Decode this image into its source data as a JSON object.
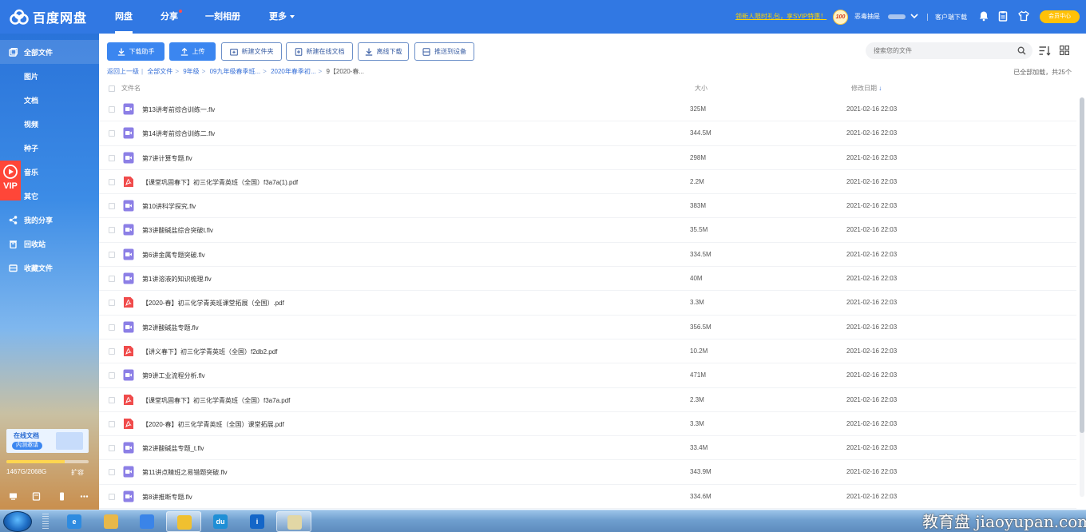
{
  "app": {
    "logo_text": "百度网盘",
    "brand_color": "#3178e3"
  },
  "nav": {
    "tabs": [
      {
        "label": "网盘",
        "active": true
      },
      {
        "label": "分享",
        "has_dot": true
      },
      {
        "label": "一刻相册"
      },
      {
        "label": "更多",
        "has_caret": true
      }
    ]
  },
  "header": {
    "promo": "领新人限时礼包，享SVIP特惠！",
    "badge": "100",
    "username": "恶毒抽是",
    "client_download": "客户端下载",
    "vip_center": "会员中心"
  },
  "sidebar": {
    "items": [
      {
        "label": "全部文件",
        "icon": "folder-icon",
        "active": true
      },
      {
        "label": "图片",
        "sub": true
      },
      {
        "label": "文档",
        "sub": true
      },
      {
        "label": "视频",
        "sub": true
      },
      {
        "label": "种子",
        "sub": true
      },
      {
        "label": "音乐",
        "sub": true
      },
      {
        "label": "其它",
        "sub": true
      },
      {
        "label": "我的分享",
        "icon": "share-icon"
      },
      {
        "label": "回收站",
        "icon": "trash-icon"
      },
      {
        "label": "收藏文件",
        "icon": "favorite-icon"
      }
    ],
    "vip_label": "VIP",
    "doc_banner": {
      "title": "在线文档",
      "tag": "内测邀请"
    },
    "quota": {
      "text": "1467G/2068G",
      "used_fraction": 0.709,
      "expand": "扩容"
    }
  },
  "toolbar": {
    "download_helper": "下载助手",
    "upload": "上传",
    "new_folder": "新建文件夹",
    "new_online_doc": "新建在线文档",
    "offline_download": "离线下载",
    "push_to_device": "推送到设备",
    "search_placeholder": "搜索您的文件"
  },
  "breadcrumb": {
    "items": [
      "返回上一级",
      "全部文件",
      "9年级",
      "09九年级春季班...",
      "2020年春季初..."
    ],
    "current": "9【2020-春...",
    "status": "已全部加载，共25个"
  },
  "columns": {
    "name": "文件名",
    "size": "大小",
    "date": "修改日期"
  },
  "files": [
    {
      "name": "第13讲考前综合训练一.flv",
      "type": "video",
      "size": "325M",
      "date": "2021-02-16 22:03"
    },
    {
      "name": "第14讲考前综合训练二.flv",
      "type": "video",
      "size": "344.5M",
      "date": "2021-02-16 22:03"
    },
    {
      "name": "第7讲计算专题.flv",
      "type": "video",
      "size": "298M",
      "date": "2021-02-16 22:03"
    },
    {
      "name": "【课堂巩固春下】初三化学青英班（全国）f3a7a(1).pdf",
      "type": "pdf",
      "size": "2.2M",
      "date": "2021-02-16 22:03"
    },
    {
      "name": "第10讲科学探究.flv",
      "type": "video",
      "size": "383M",
      "date": "2021-02-16 22:03"
    },
    {
      "name": "第3讲酸碱盐综合突破t.flv",
      "type": "video",
      "size": "35.5M",
      "date": "2021-02-16 22:03"
    },
    {
      "name": "第6讲金属专题突破.flv",
      "type": "video",
      "size": "334.5M",
      "date": "2021-02-16 22:03"
    },
    {
      "name": "第1讲溶液的知识梳理.flv",
      "type": "video",
      "size": "40M",
      "date": "2021-02-16 22:03"
    },
    {
      "name": "【2020-春】初三化学青英班课堂拓展（全国）.pdf",
      "type": "pdf",
      "size": "3.3M",
      "date": "2021-02-16 22:03"
    },
    {
      "name": "第2讲酸碱盐专题.flv",
      "type": "video",
      "size": "356.5M",
      "date": "2021-02-16 22:03"
    },
    {
      "name": "【讲义春下】初三化学青英班（全国）f2db2.pdf",
      "type": "pdf",
      "size": "10.2M",
      "date": "2021-02-16 22:03"
    },
    {
      "name": "第9讲工业流程分析.flv",
      "type": "video",
      "size": "471M",
      "date": "2021-02-16 22:03"
    },
    {
      "name": "【课堂巩固春下】初三化学青英班（全国）f3a7a.pdf",
      "type": "pdf",
      "size": "2.3M",
      "date": "2021-02-16 22:03"
    },
    {
      "name": "【2020-春】初三化学青英班（全国）课堂拓展.pdf",
      "type": "pdf",
      "size": "3.3M",
      "date": "2021-02-16 22:03"
    },
    {
      "name": "第2讲酸碱盐专题_t.flv",
      "type": "video",
      "size": "33.4M",
      "date": "2021-02-16 22:03"
    },
    {
      "name": "第11讲点睛班之易错题突破.flv",
      "type": "video",
      "size": "343.9M",
      "date": "2021-02-16 22:03"
    },
    {
      "name": "第8讲推断专题.flv",
      "type": "video",
      "size": "334.6M",
      "date": "2021-02-16 22:03"
    }
  ],
  "taskbar": {
    "buttons": [
      {
        "icon": "ie-icon",
        "color": "#2e8be0",
        "glyph": "e"
      },
      {
        "icon": "explorer-icon",
        "color": "#e8b84a",
        "glyph": ""
      },
      {
        "icon": "baidu-netdisk-icon",
        "color": "#3a84e8",
        "glyph": ""
      },
      {
        "icon": "chrome-icon",
        "color": "#f0c030",
        "glyph": "",
        "open": true
      },
      {
        "icon": "du-icon",
        "color": "#1f8fd6",
        "glyph": "du"
      },
      {
        "icon": "download-manager-icon",
        "color": "#1466c8",
        "glyph": "i"
      },
      {
        "icon": "paint-icon",
        "color": "#e2d7a5",
        "glyph": "",
        "open": true
      }
    ],
    "watermark": "教育盘 jiaoyupan.com"
  }
}
